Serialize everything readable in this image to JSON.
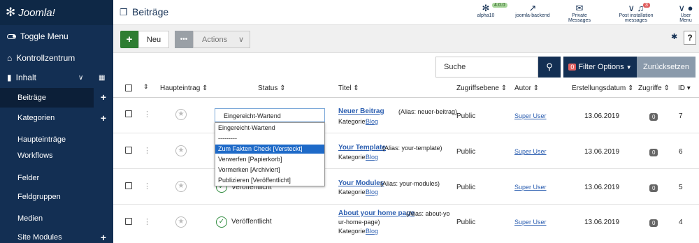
{
  "brand": {
    "logo_text": "Joomla!"
  },
  "header": {
    "title": "Beiträge",
    "version_badge": "4.0.0",
    "alpha_label": "alpha10",
    "backend_label": "joomla-backend",
    "messages_label": "Private Messages",
    "postinstall_label": "Post installation messages",
    "postinstall_count": "3",
    "user_label": "User Menu"
  },
  "sidebar": {
    "toggle": "Toggle Menu",
    "dashboard": "Kontrollzentrum",
    "content": "Inhalt",
    "items": [
      {
        "label": "Beiträge",
        "plus": "+"
      },
      {
        "label": "Kategorien",
        "plus": "+"
      },
      {
        "label": "Haupteinträge"
      },
      {
        "label": "Workflows"
      },
      {
        "label": "Felder"
      },
      {
        "label": "Feldgruppen"
      },
      {
        "label": "Medien"
      },
      {
        "label": "Site Modules",
        "plus": "+"
      }
    ]
  },
  "toolbar": {
    "new_label": "Neu",
    "actions_label": "Actions",
    "help_label": "?"
  },
  "filters": {
    "search_placeholder": "Suche",
    "filter_options": "Filter Options",
    "filter_count": "0",
    "reset": "Zurücksetzen"
  },
  "table": {
    "headers": {
      "featured": "Haupteintrag",
      "status": "Status",
      "title": "Titel",
      "access": "Zugriffsebene",
      "author": "Autor",
      "created": "Erstellungsdatum",
      "hits": "Zugriffe",
      "id": "ID"
    },
    "rows": [
      {
        "title": "Neuer Beitrag",
        "alias": "(Alias: neuer-beitrag)",
        "category_prefix": "Kategorie:",
        "category": "Blog",
        "access": "Public",
        "author": "Super User",
        "date": "13.06.2019",
        "hits": "0",
        "id": "7",
        "status": "Eingereicht-Wartend"
      },
      {
        "title": "Your Template",
        "alias": "(Alias: your-template)",
        "category_prefix": "Kategorie:",
        "category": "Blog",
        "access": "Public",
        "author": "Super User",
        "date": "13.06.2019",
        "hits": "0",
        "id": "6",
        "status": ""
      },
      {
        "title": "Your Modules",
        "alias": "(Alias: your-modules)",
        "category_prefix": "Kategorie:",
        "category": "Blog",
        "access": "Public",
        "author": "Super User",
        "date": "13.06.2019",
        "hits": "0",
        "id": "5",
        "status": "Veröffentlicht"
      },
      {
        "title": "About your home page",
        "alias": "(Alias: about-yo",
        "alias2": "ur-home-page)",
        "category_prefix": "Kategorie:",
        "category": "Blog",
        "access": "Public",
        "author": "Super User",
        "date": "13.06.2019",
        "hits": "0",
        "id": "4",
        "status": "Veröffentlicht"
      }
    ]
  },
  "dropdown": {
    "current": "Eingereicht-Wartend",
    "options": [
      "Eingereicht-Wartend",
      "---------",
      "Zum Fakten Check [Versteckt]",
      "Verwerfen [Papierkorb]",
      "Vormerken [Archiviert]",
      "Publizieren [Veröffentlicht]"
    ],
    "highlighted_index": 2
  },
  "colors": {
    "sidebar": "#132f53",
    "primary": "#132f53",
    "success": "#2e7d32",
    "highlight": "#1e6ac8"
  }
}
